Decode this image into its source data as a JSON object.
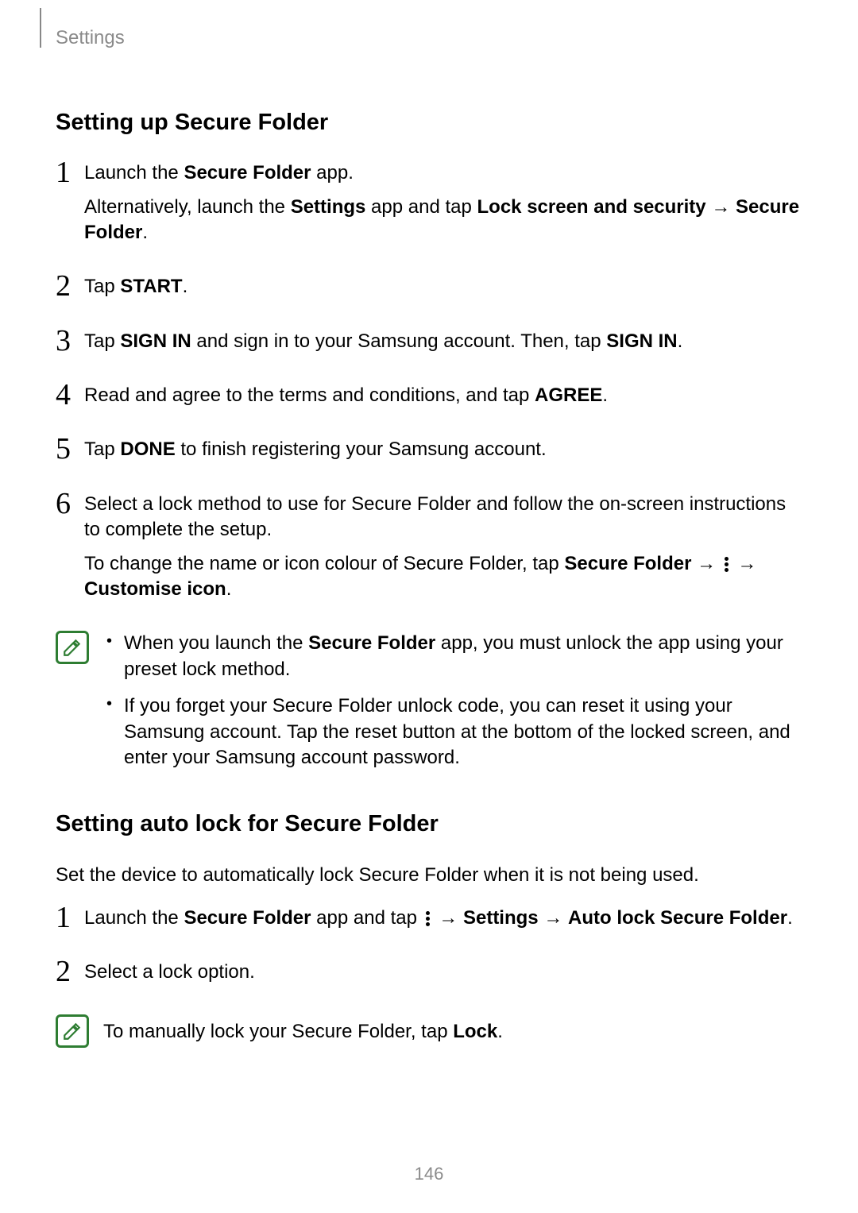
{
  "header": {
    "label": "Settings"
  },
  "section1": {
    "title": "Setting up Secure Folder",
    "steps": [
      {
        "num": "1",
        "p1_a": "Launch the ",
        "p1_b": "Secure Folder",
        "p1_c": " app.",
        "p2_a": "Alternatively, launch the ",
        "p2_b": "Settings",
        "p2_c": " app and tap ",
        "p2_d": "Lock screen and security",
        "p2_e": " → ",
        "p2_f": "Secure Folder",
        "p2_g": "."
      },
      {
        "num": "2",
        "p1_a": "Tap ",
        "p1_b": "START",
        "p1_c": "."
      },
      {
        "num": "3",
        "p1_a": "Tap ",
        "p1_b": "SIGN IN",
        "p1_c": " and sign in to your Samsung account. Then, tap ",
        "p1_d": "SIGN IN",
        "p1_e": "."
      },
      {
        "num": "4",
        "p1_a": "Read and agree to the terms and conditions, and tap ",
        "p1_b": "AGREE",
        "p1_c": "."
      },
      {
        "num": "5",
        "p1_a": "Tap ",
        "p1_b": "DONE",
        "p1_c": " to finish registering your Samsung account."
      },
      {
        "num": "6",
        "p1": "Select a lock method to use for Secure Folder and follow the on-screen instructions to complete the setup.",
        "p2_a": "To change the name or icon colour of Secure Folder, tap ",
        "p2_b": "Secure Folder",
        "p2_c": " → ",
        "p2_d": " → ",
        "p2_e": "Customise icon",
        "p2_f": "."
      }
    ],
    "notes": [
      {
        "a": "When you launch the ",
        "b": "Secure Folder",
        "c": " app, you must unlock the app using your preset lock method."
      },
      {
        "a": "If you forget your Secure Folder unlock code, you can reset it using your Samsung account. Tap the reset button at the bottom of the locked screen, and enter your Samsung account password."
      }
    ]
  },
  "section2": {
    "title": "Setting auto lock for Secure Folder",
    "intro": "Set the device to automatically lock Secure Folder when it is not being used.",
    "steps": [
      {
        "num": "1",
        "p1_a": "Launch the ",
        "p1_b": "Secure Folder",
        "p1_c": " app and tap ",
        "p1_d": " → ",
        "p1_e": "Settings",
        "p1_f": " → ",
        "p1_g": "Auto lock Secure Folder",
        "p1_h": "."
      },
      {
        "num": "2",
        "p1": "Select a lock option."
      }
    ],
    "note_a": "To manually lock your Secure Folder, tap ",
    "note_b": "Lock",
    "note_c": "."
  },
  "pageNumber": "146"
}
